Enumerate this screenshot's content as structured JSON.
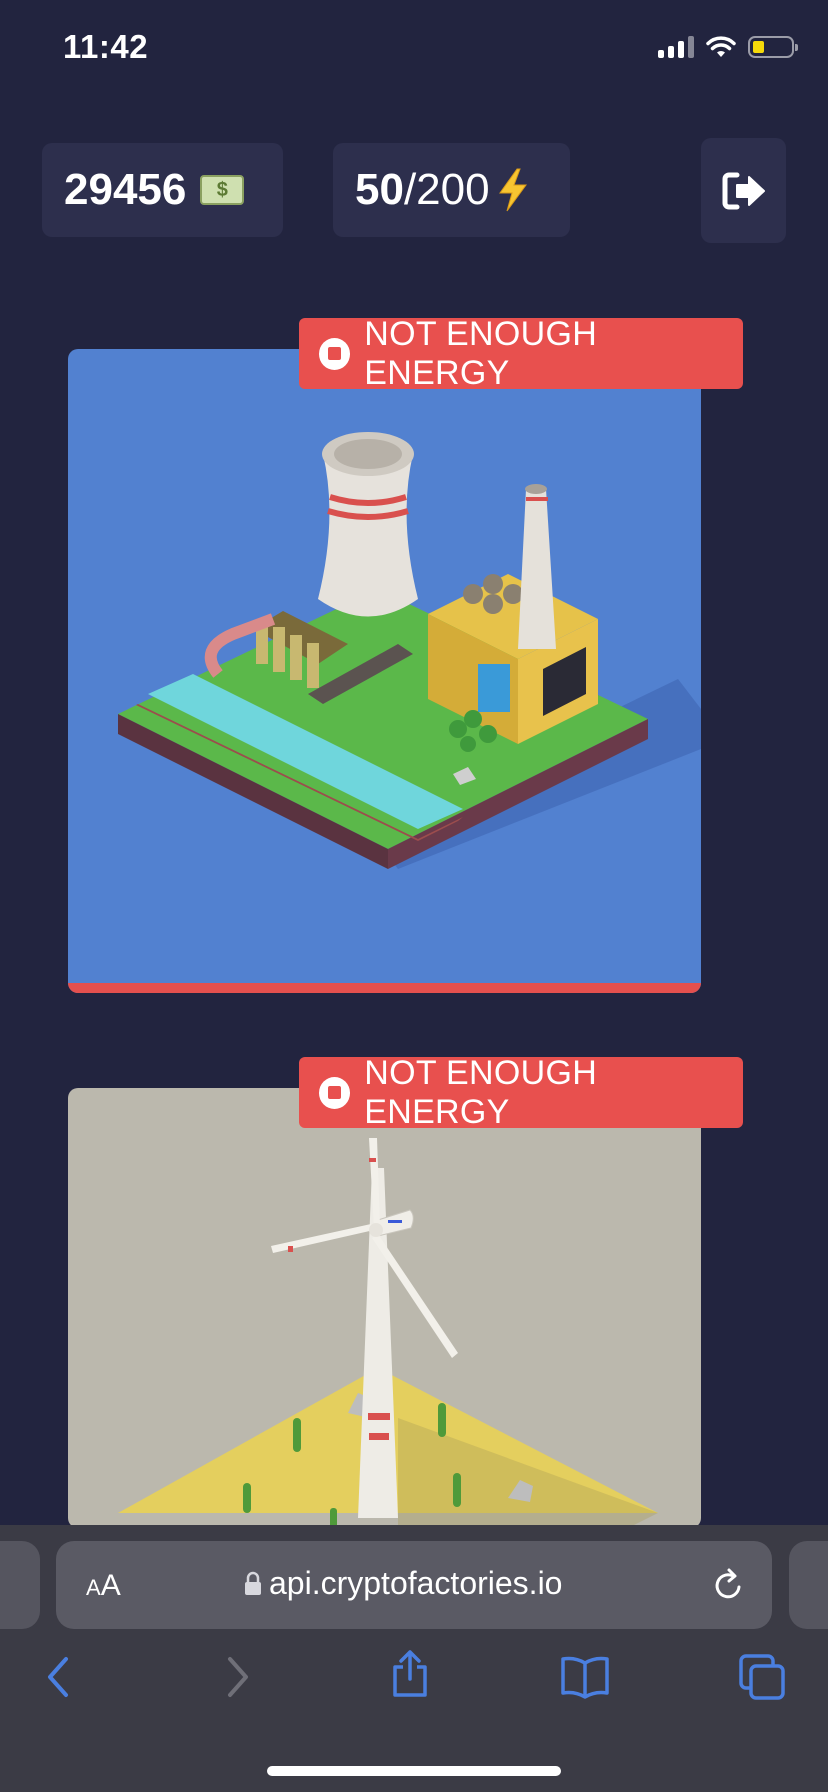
{
  "status_bar": {
    "time": "11:42"
  },
  "stats": {
    "money_value": "29456",
    "money_icon": "money-bill-icon",
    "energy_current": "50",
    "energy_max": "/200",
    "energy_icon": "lightning-icon"
  },
  "cards": [
    {
      "badge": "NOT ENOUGH ENERGY",
      "scene": "power-plant"
    },
    {
      "badge": "NOT ENOUGH ENERGY",
      "scene": "wind-turbine"
    }
  ],
  "browser": {
    "text_size_small": "A",
    "text_size_large": "A",
    "url": "api.cryptofactories.io"
  },
  "colors": {
    "background": "#22243f",
    "panel": "#2d2f4d",
    "badge": "#e8504e",
    "card1_bg": "#5281d0",
    "card2_bg": "#bbb8ad",
    "browser_accent": "#4a7fe0"
  }
}
